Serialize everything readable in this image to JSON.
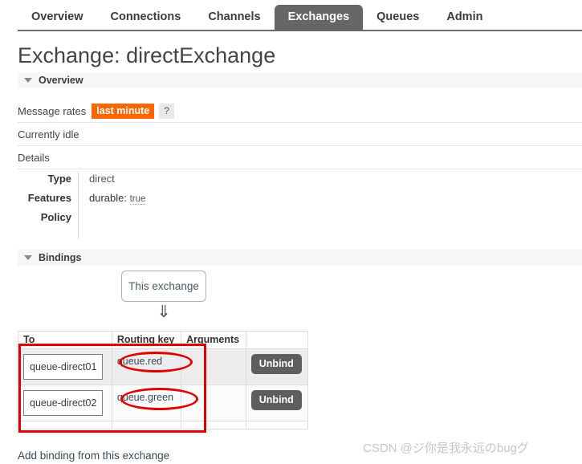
{
  "nav": {
    "tabs": [
      {
        "label": "Overview",
        "active": false
      },
      {
        "label": "Connections",
        "active": false
      },
      {
        "label": "Channels",
        "active": false
      },
      {
        "label": "Exchanges",
        "active": true
      },
      {
        "label": "Queues",
        "active": false
      },
      {
        "label": "Admin",
        "active": false
      }
    ]
  },
  "page": {
    "title": "Exchange: directExchange"
  },
  "overview": {
    "header": "Overview",
    "rates_label": "Message rates",
    "rates_period": "last minute",
    "help": "?",
    "status": "Currently idle",
    "details_label": "Details",
    "details": [
      {
        "label": "Type",
        "value": "direct"
      },
      {
        "label": "Features",
        "value": ""
      },
      {
        "label": "Policy",
        "value": ""
      }
    ],
    "features": {
      "key": "durable:",
      "value": "true"
    }
  },
  "bindings": {
    "header": "Bindings",
    "source_box": "This exchange",
    "arrow": "⇓",
    "columns": [
      "To",
      "Routing key",
      "Arguments",
      ""
    ],
    "rows": [
      {
        "to": "queue-direct01",
        "routing_key": "queue.red",
        "arguments": "",
        "action": "Unbind"
      },
      {
        "to": "queue-direct02",
        "routing_key": "queue.green",
        "arguments": "",
        "action": "Unbind"
      }
    ],
    "add_link": "Add binding from this exchange"
  },
  "colors": {
    "accent_orange": "#ff6600",
    "active_tab": "#666666",
    "annotation_red": "#e00000",
    "unbind_gray": "#5e5e5e"
  },
  "watermark": {
    "text": "CSDN @ジ你是我永远のbugグ"
  }
}
